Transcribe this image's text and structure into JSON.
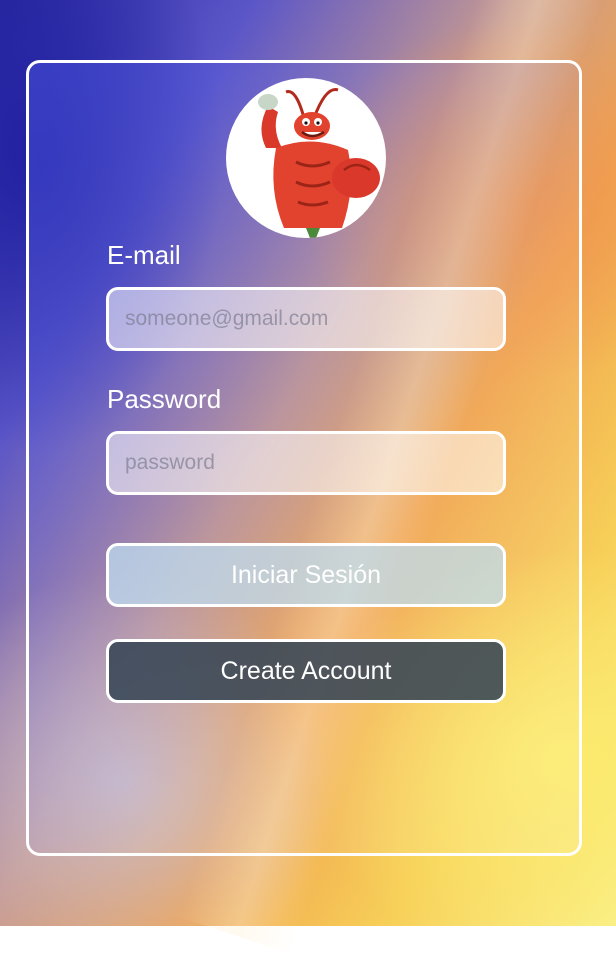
{
  "form": {
    "email_label": "E-mail",
    "email_placeholder": "someone@gmail.com",
    "password_label": "Password",
    "password_placeholder": "password",
    "login_button": "Iniciar Sesión",
    "create_button": "Create Account"
  },
  "avatar": {
    "icon": "cartoon-lobster-avatar"
  },
  "colors": {
    "login_button_bg": "#bedcf0",
    "create_button_bg": "#374655",
    "border": "#ffffff"
  }
}
